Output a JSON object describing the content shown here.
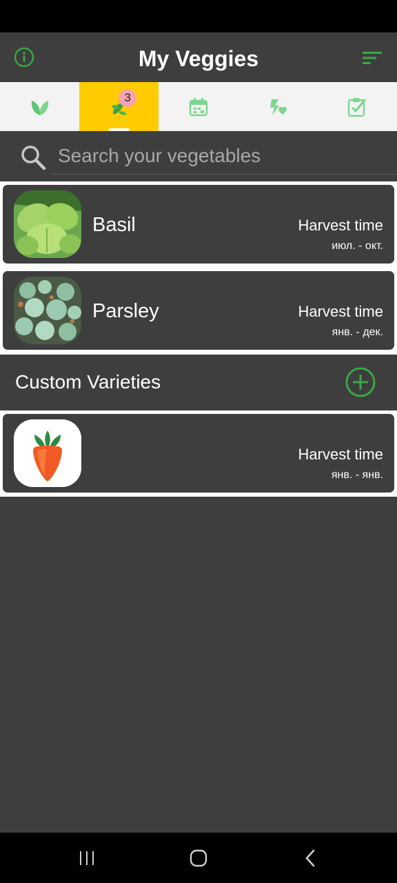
{
  "app": {
    "title": "My Veggies"
  },
  "tabs": [
    {
      "name": "leaf-tab",
      "active": false
    },
    {
      "name": "my-plants-tab",
      "active": true,
      "badge": "3"
    },
    {
      "name": "calendar-tab",
      "active": false
    },
    {
      "name": "companions-tab",
      "active": false
    },
    {
      "name": "tasks-tab",
      "active": false
    }
  ],
  "search": {
    "placeholder": "Search your vegetables"
  },
  "vegetables": [
    {
      "name": "Basil",
      "harvest_label": "Harvest time",
      "harvest_months": "июл. - окт."
    },
    {
      "name": "Parsley",
      "harvest_label": "Harvest time",
      "harvest_months": "янв. - дек."
    }
  ],
  "custom": {
    "section_title": "Custom Varieties",
    "items": [
      {
        "name": "",
        "harvest_label": "Harvest time",
        "harvest_months": "янв. - янв."
      }
    ]
  },
  "colors": {
    "accent_green": "#3aa845",
    "tab_active": "#ffcc00",
    "badge": "#f7a3b3"
  }
}
